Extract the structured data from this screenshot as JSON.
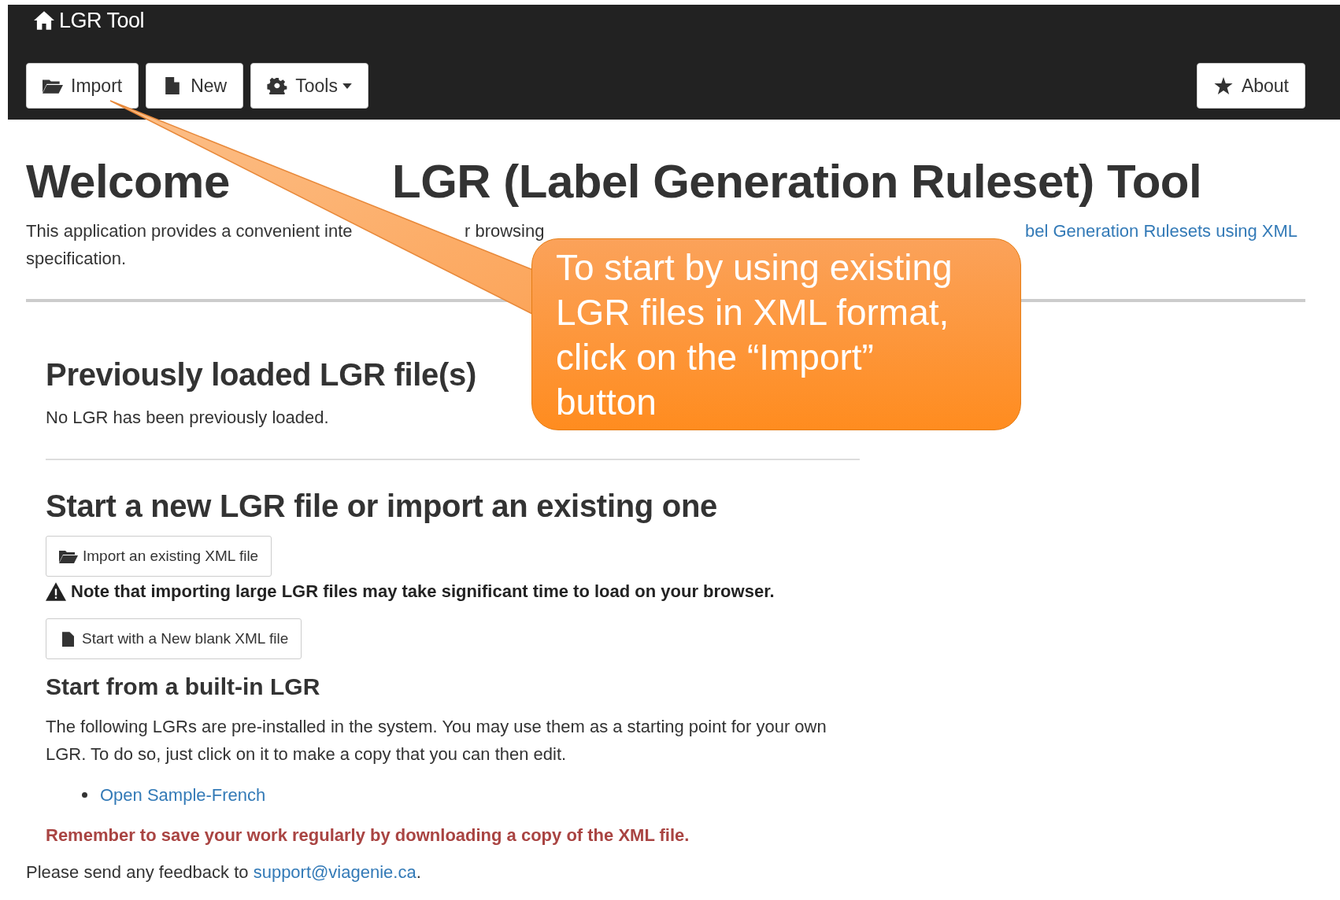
{
  "navbar": {
    "brand": "LGR Tool",
    "buttons": [
      {
        "label": "Import",
        "kind": "import",
        "dropdown": false
      },
      {
        "label": "New",
        "kind": "new",
        "dropdown": false
      },
      {
        "label": "Tools",
        "kind": "tools",
        "dropdown": true
      },
      {
        "label": "About",
        "kind": "about",
        "dropdown": false
      }
    ]
  },
  "title": [
    "Welcome",
    "LGR (Label Generation Ruleset) Tool"
  ],
  "intro": {
    "fragments": [
      "This application provides a convenient inte",
      "r browsing"
    ],
    "link": "bel Generation Rulesets using XML",
    "tail": "specification."
  },
  "callout": {
    "text": "To start by using existing LGR files in XML format, click on the “Import” button"
  },
  "previous": {
    "heading": "Previously loaded LGR file(s)",
    "text": "No LGR has been previously loaded."
  },
  "start": {
    "heading": "Start a new LGR file or import an existing one",
    "import_button": "Import an existing XML file",
    "note": "Note that importing large LGR files may take significant time to load on your browser.",
    "new_button": "Start with a New blank XML file"
  },
  "builtin": {
    "heading": "Start from a built-in LGR",
    "text": "The following LGRs are pre-installed in the system. You may use them as a starting point for your own LGR. To do so, just click on it to make a copy that you can then edit.",
    "links": [
      "Open Sample-French"
    ]
  },
  "reminder": "Remember to save your work regularly by downloading a copy of the XML file.",
  "feedback": {
    "text": "Please send any feedback to",
    "link": "support@viagenie.ca",
    "tail": "."
  }
}
